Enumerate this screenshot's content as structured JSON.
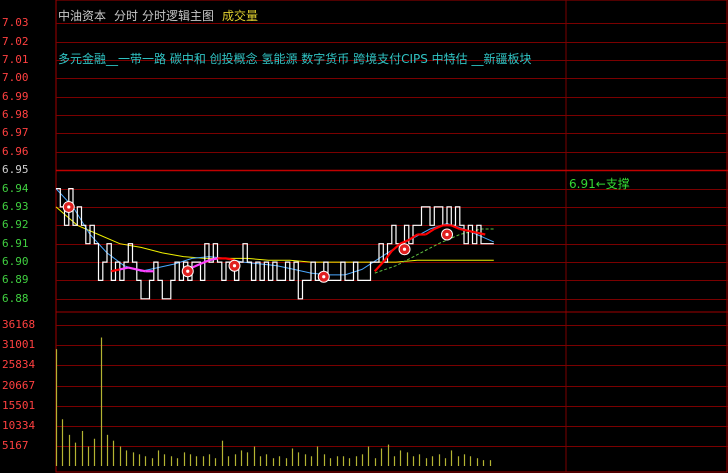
{
  "header": {
    "stock_name": "中油资本",
    "tab_timeshare": "分时",
    "tab_logic": "分时逻辑主图",
    "tab_volume": "成交量"
  },
  "concepts_text": "多元金融__一带一路 碳中和 创投概念 氢能源 数字货币 跨境支付CIPS 中特估 __新疆板块",
  "annotations": {
    "support_label": "6.91←支撑",
    "support_price": 6.91
  },
  "colors": {
    "background": "#000000",
    "grid": "#7a0000",
    "axis_border": "#a00000",
    "price_line": "#ffffff",
    "avg_line": "#f0f000",
    "ma_line": "#4aa8ff",
    "up_line": "#ff0000",
    "down_line": "#ff40ff",
    "volume": "#b4b432",
    "price_label_up": "#ff4040",
    "price_label_base": "#d0d0d0",
    "price_label_down": "#40d040",
    "marker": "#e02020"
  },
  "chart_data": [
    {
      "type": "line",
      "title": "",
      "y_ticks": [
        7.03,
        7.02,
        7.01,
        7.0,
        6.99,
        6.98,
        6.97,
        6.96,
        6.95,
        6.94,
        6.93,
        6.92,
        6.91,
        6.9,
        6.89,
        6.88
      ],
      "y_tick_labels": [
        "7.03",
        "7.02",
        "7.01",
        "7.00",
        "6.99",
        "6.98",
        "6.97",
        "6.96",
        "6.95",
        "6.94",
        "6.93",
        "6.92",
        "6.91",
        "6.90",
        "6.89",
        "6.88"
      ],
      "ylim": [
        6.875,
        7.035
      ],
      "prev_close": 6.95,
      "x_slots": 240,
      "series": [
        {
          "key": "price",
          "x": [
            0,
            2,
            4,
            6,
            8,
            10,
            12,
            14,
            16,
            18,
            20,
            22,
            24,
            26,
            28,
            30,
            32,
            34,
            36,
            38,
            40,
            42,
            44,
            46,
            48,
            50,
            52,
            54,
            56,
            58,
            60,
            62,
            64,
            66,
            68,
            70,
            72,
            74,
            76,
            78,
            80,
            82,
            84,
            86,
            88,
            90,
            92,
            94,
            96,
            98,
            100,
            102,
            104,
            106,
            108,
            110,
            112,
            114,
            116,
            118,
            120,
            122,
            124,
            126,
            128,
            130,
            132,
            134,
            136,
            138,
            140,
            142,
            144,
            146,
            148,
            150,
            152,
            154,
            156,
            158,
            160,
            162,
            164,
            166,
            168,
            170,
            172,
            174,
            176,
            178,
            180,
            182,
            184,
            186,
            188,
            190,
            192,
            194,
            196,
            198,
            200,
            202,
            204,
            206
          ],
          "values": [
            6.94,
            6.93,
            6.92,
            6.94,
            6.92,
            6.93,
            6.92,
            6.91,
            6.92,
            6.91,
            6.89,
            6.9,
            6.91,
            6.89,
            6.9,
            6.89,
            6.9,
            6.91,
            6.9,
            6.89,
            6.88,
            6.88,
            6.89,
            6.9,
            6.89,
            6.88,
            6.88,
            6.89,
            6.9,
            6.89,
            6.9,
            6.89,
            6.9,
            6.9,
            6.89,
            6.91,
            6.9,
            6.91,
            6.9,
            6.89,
            6.9,
            6.9,
            6.89,
            6.9,
            6.91,
            6.9,
            6.89,
            6.9,
            6.89,
            6.9,
            6.89,
            6.9,
            6.89,
            6.89,
            6.9,
            6.89,
            6.9,
            6.88,
            6.89,
            6.89,
            6.9,
            6.89,
            6.89,
            6.9,
            6.89,
            6.89,
            6.89,
            6.9,
            6.89,
            6.89,
            6.9,
            6.89,
            6.89,
            6.89,
            6.9,
            6.9,
            6.91,
            6.9,
            6.91,
            6.92,
            6.91,
            6.91,
            6.92,
            6.91,
            6.92,
            6.92,
            6.93,
            6.93,
            6.92,
            6.93,
            6.93,
            6.92,
            6.93,
            6.92,
            6.93,
            6.92,
            6.91,
            6.92,
            6.91,
            6.92,
            6.91,
            6.91,
            6.91,
            6.91
          ]
        },
        {
          "key": "avg",
          "x": [
            0,
            10,
            20,
            30,
            40,
            50,
            60,
            70,
            80,
            90,
            100,
            110,
            120,
            130,
            140,
            150,
            160,
            170,
            180,
            190,
            200,
            206
          ],
          "values": [
            6.93,
            6.92,
            6.915,
            6.91,
            6.908,
            6.905,
            6.903,
            6.902,
            6.902,
            6.902,
            6.901,
            6.901,
            6.9,
            6.9,
            6.9,
            6.9,
            6.9,
            6.901,
            6.901,
            6.901,
            6.901,
            6.901
          ]
        },
        {
          "key": "ma",
          "x": [
            0,
            8,
            16,
            24,
            32,
            40,
            48,
            56,
            64,
            72,
            80,
            88,
            96,
            104,
            112,
            120,
            128,
            136,
            144,
            152,
            160,
            168,
            176,
            184,
            192,
            200,
            206
          ],
          "values": [
            6.94,
            6.93,
            6.915,
            6.905,
            6.898,
            6.895,
            6.897,
            6.899,
            6.902,
            6.903,
            6.902,
            6.9,
            6.899,
            6.898,
            6.896,
            6.894,
            6.893,
            6.893,
            6.896,
            6.902,
            6.908,
            6.913,
            6.918,
            6.921,
            6.918,
            6.914,
            6.911
          ]
        },
        {
          "key": "trend",
          "x": [
            26,
            30,
            34,
            38,
            42,
            46,
            60,
            64,
            68,
            72,
            76,
            80,
            84,
            150,
            154,
            158,
            162,
            166,
            170,
            174,
            178,
            182,
            186,
            190,
            194,
            198,
            202
          ],
          "values": [
            6.895,
            6.896,
            6.897,
            6.896,
            6.895,
            6.895,
            6.895,
            6.897,
            6.899,
            6.901,
            6.902,
            6.902,
            6.901,
            6.895,
            6.9,
            6.906,
            6.91,
            6.912,
            6.915,
            6.915,
            6.918,
            6.92,
            6.92,
            6.918,
            6.917,
            6.916,
            6.915
          ],
          "colors": [
            "up",
            "up",
            "down",
            "down",
            "down",
            "down",
            "up",
            "down",
            "down",
            "down",
            "down",
            "up",
            "up",
            "up",
            "up",
            "up",
            "up",
            "up",
            "up",
            "up",
            "up",
            "up",
            "up",
            "up",
            "up",
            "up",
            "up"
          ]
        },
        {
          "key": "dashed",
          "x": [
            150,
            160,
            170,
            180,
            190,
            200,
            206
          ],
          "values": [
            6.894,
            6.898,
            6.904,
            6.91,
            6.915,
            6.918,
            6.918
          ]
        }
      ],
      "markers": [
        {
          "x": 6,
          "value": 6.93
        },
        {
          "x": 62,
          "value": 6.895
        },
        {
          "x": 84,
          "value": 6.898
        },
        {
          "x": 126,
          "value": 6.892
        },
        {
          "x": 164,
          "value": 6.907
        },
        {
          "x": 184,
          "value": 6.915
        }
      ]
    },
    {
      "type": "bar",
      "title": "",
      "y_ticks": [
        36168,
        31001,
        25834,
        20667,
        15501,
        10334,
        5167
      ],
      "y_tick_labels": [
        "36168",
        "31001",
        "25834",
        "20667",
        "15501",
        "10334",
        "5167"
      ],
      "ylim": [
        0,
        38000
      ],
      "x_slots": 240,
      "x": [
        0,
        3,
        6,
        9,
        12,
        15,
        18,
        21,
        24,
        27,
        30,
        33,
        36,
        39,
        42,
        45,
        48,
        51,
        54,
        57,
        60,
        63,
        66,
        69,
        72,
        75,
        78,
        81,
        84,
        87,
        90,
        93,
        96,
        99,
        102,
        105,
        108,
        111,
        114,
        117,
        120,
        123,
        126,
        129,
        132,
        135,
        138,
        141,
        144,
        147,
        150,
        153,
        156,
        159,
        162,
        165,
        168,
        171,
        174,
        177,
        180,
        183,
        186,
        189,
        192,
        195,
        198,
        201,
        204
      ],
      "values": [
        30000,
        12000,
        8000,
        6000,
        9000,
        5000,
        7000,
        33000,
        8000,
        6500,
        5000,
        4000,
        3500,
        3000,
        2500,
        2000,
        4000,
        3000,
        2500,
        2000,
        3500,
        3000,
        2500,
        2500,
        3000,
        2000,
        6500,
        2500,
        3000,
        4000,
        3500,
        5000,
        2500,
        3000,
        2000,
        2500,
        2000,
        4500,
        3500,
        3000,
        2500,
        5000,
        3000,
        2000,
        2500,
        2500,
        2000,
        2500,
        3000,
        5000,
        2000,
        4500,
        5500,
        2500,
        4000,
        3500,
        2500,
        3000,
        2000,
        2500,
        3000,
        2000,
        4000,
        2500,
        3000,
        2500,
        2000,
        1500,
        1500
      ]
    }
  ]
}
